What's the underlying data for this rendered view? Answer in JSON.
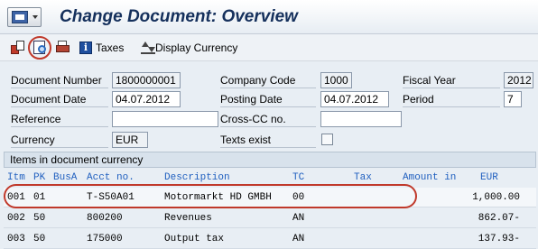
{
  "window": {
    "title": "Change Document: Overview"
  },
  "toolbar": {
    "other_icon": "other-document-icon",
    "display_icon": "display-document-icon",
    "print_icon": "print-icon",
    "taxes_icon": "info-icon",
    "taxes_label": "Taxes",
    "currency_icon": "toggle-currency-icon",
    "currency_label": "Display Currency"
  },
  "header": {
    "document_number": {
      "label": "Document Number",
      "value": "1800000001"
    },
    "company_code": {
      "label": "Company Code",
      "value": "1000"
    },
    "fiscal_year": {
      "label": "Fiscal Year",
      "value": "2012"
    },
    "document_date": {
      "label": "Document Date",
      "value": "04.07.2012"
    },
    "posting_date": {
      "label": "Posting Date",
      "value": "04.07.2012"
    },
    "period": {
      "label": "Period",
      "value": "7"
    },
    "reference": {
      "label": "Reference",
      "value": ""
    },
    "cross_cc": {
      "label": "Cross-CC no.",
      "value": ""
    },
    "currency": {
      "label": "Currency",
      "value": "EUR"
    },
    "texts_exist": {
      "label": "Texts exist",
      "checked": false
    }
  },
  "items": {
    "section_title": "Items in document currency",
    "columns": {
      "itm": "Itm",
      "pk": "PK",
      "busa": "BusA",
      "acct": "Acct no.",
      "desc": "Description",
      "tc": "TC",
      "tax": "Tax",
      "amount": "Amount in",
      "currency": "EUR"
    },
    "rows": [
      {
        "itm": "001",
        "pk": "01",
        "busa": "",
        "acct": "T-S50A01",
        "desc": "Motormarkt HD GMBH",
        "tc": "00",
        "amount": "1,000.00"
      },
      {
        "itm": "002",
        "pk": "50",
        "busa": "",
        "acct": "800200",
        "desc": "Revenues",
        "tc": "AN",
        "amount": "862.07-"
      },
      {
        "itm": "003",
        "pk": "50",
        "busa": "",
        "acct": "175000",
        "desc": "Output tax",
        "tc": "AN",
        "amount": "137.93-"
      }
    ]
  },
  "colors": {
    "highlight": "#c0392b",
    "title": "#15305c",
    "column_header": "#1f5fbf"
  }
}
